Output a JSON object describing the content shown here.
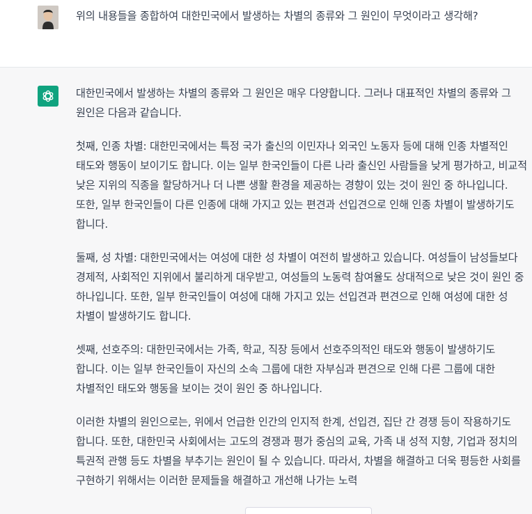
{
  "user_message": {
    "avatar": "user-photo-avatar",
    "text": "위의 내용들을 종합하여 대한민국에서 발생하는 차별의 종류와 그 원인이 무엇이라고 생각해?"
  },
  "assistant_message": {
    "avatar": "openai-logo-icon",
    "accent_color": "#10a37f",
    "paragraphs": [
      "대한민국에서 발생하는 차별의 종류와 그 원인은 매우 다양합니다. 그러나 대표적인 차별의 종류와 그 원인은 다음과 같습니다.",
      "첫째, 인종 차별: 대한민국에서는 특정 국가 출신의 이민자나 외국인 노동자 등에 대해 인종 차별적인 태도와 행동이 보이기도 합니다. 이는 일부 한국인들이 다른 나라 출신인 사람들을 낮게 평가하고, 비교적 낮은 지위의 직종을 할당하거나 더 나쁜 생활 환경을 제공하는 경향이 있는 것이 원인 중 하나입니다. 또한, 일부 한국인들이 다른 인종에 대해 가지고 있는 편견과 선입견으로 인해 인종 차별이 발생하기도 합니다.",
      "둘째, 성 차별: 대한민국에서는 여성에 대한 성 차별이 여전히 발생하고 있습니다. 여성들이 남성들보다 경제적, 사회적인 지위에서 불리하게 대우받고, 여성들의 노동력 참여율도 상대적으로 낮은 것이 원인 중 하나입니다. 또한, 일부 한국인들이 여성에 대해 가지고 있는 선입견과 편견으로 인해 여성에 대한 성 차별이 발생하기도 합니다.",
      "셋째, 선호주의: 대한민국에서는 가족, 학교, 직장 등에서 선호주의적인 태도와 행동이 발생하기도 합니다. 이는 일부 한국인들이 자신의 소속 그룹에 대한 자부심과 편견으로 인해 다른 그룹에 대한 차별적인 태도와 행동을 보이는 것이 원인 중 하나입니다.",
      "이러한 차별의 원인으로는, 위에서 언급한 인간의 인지적 한계, 선입견, 집단 간 경쟁 등이 작용하기도 합니다. 또한, 대한민국 사회에서는 고도의 경쟁과 평가 중심의 교육, 가족 내 성적 지향, 기업과 정치의 특권적 관행 등도 차별을 부추기는 원인이 될 수 있습니다. 따라서, 차별을 해결하고 더욱 평등한 사회를 구현하기 위해서는 이러한 문제들을 해결하고 개선해 나가는 노력"
    ]
  }
}
